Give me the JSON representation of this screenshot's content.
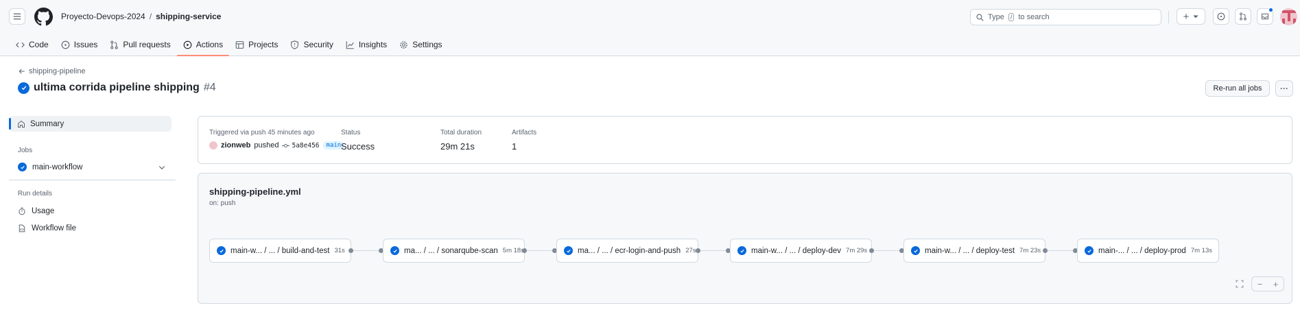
{
  "header": {
    "owner": "Proyecto-Devops-2024",
    "separator": "/",
    "repo": "shipping-service",
    "search_prefix": "Type",
    "search_key": "/",
    "search_suffix": "to search",
    "create_label": "+"
  },
  "nav": {
    "tabs": [
      {
        "label": "Code",
        "icon": "code-icon"
      },
      {
        "label": "Issues",
        "icon": "issue-icon"
      },
      {
        "label": "Pull requests",
        "icon": "pull-request-icon"
      },
      {
        "label": "Actions",
        "icon": "play-icon",
        "active": true
      },
      {
        "label": "Projects",
        "icon": "table-icon"
      },
      {
        "label": "Security",
        "icon": "shield-icon"
      },
      {
        "label": "Insights",
        "icon": "graph-icon"
      },
      {
        "label": "Settings",
        "icon": "gear-icon"
      }
    ]
  },
  "page": {
    "back_label": "shipping-pipeline",
    "title": "ultima corrida pipeline shipping",
    "run_number": "#4",
    "rerun_label": "Re-run all jobs",
    "more_label": "···"
  },
  "sidebar": {
    "summary_label": "Summary",
    "jobs_heading": "Jobs",
    "job_item": "main-workflow",
    "run_details_heading": "Run details",
    "usage_label": "Usage",
    "workflow_file_label": "Workflow file"
  },
  "summary": {
    "triggered_label": "Triggered via push 45 minutes ago",
    "user": "zionweb",
    "action": "pushed",
    "sha": "5a8e456",
    "branch": "main",
    "status_label": "Status",
    "status_value": "Success",
    "duration_label": "Total duration",
    "duration_value": "29m 21s",
    "artifacts_label": "Artifacts",
    "artifacts_value": "1"
  },
  "workflow": {
    "file": "shipping-pipeline.yml",
    "trigger": "on: push",
    "jobs": [
      {
        "name": "main-w... / ... / build-and-test",
        "duration": "31s"
      },
      {
        "name": "ma... / ... / sonarqube-scan",
        "duration": "5m 18s"
      },
      {
        "name": "ma... / ... / ecr-login-and-push",
        "duration": "27s"
      },
      {
        "name": "main-w... / ... / deploy-dev",
        "duration": "7m 29s"
      },
      {
        "name": "main-w... / ... / deploy-test",
        "duration": "7m 23s"
      },
      {
        "name": "main-... / ... / deploy-prod",
        "duration": "7m 13s"
      }
    ],
    "zoom_out": "−",
    "zoom_in": "+"
  },
  "colors": {
    "accent": "#0969da",
    "active_tab": "#fd8c73",
    "muted": "#59636e"
  }
}
